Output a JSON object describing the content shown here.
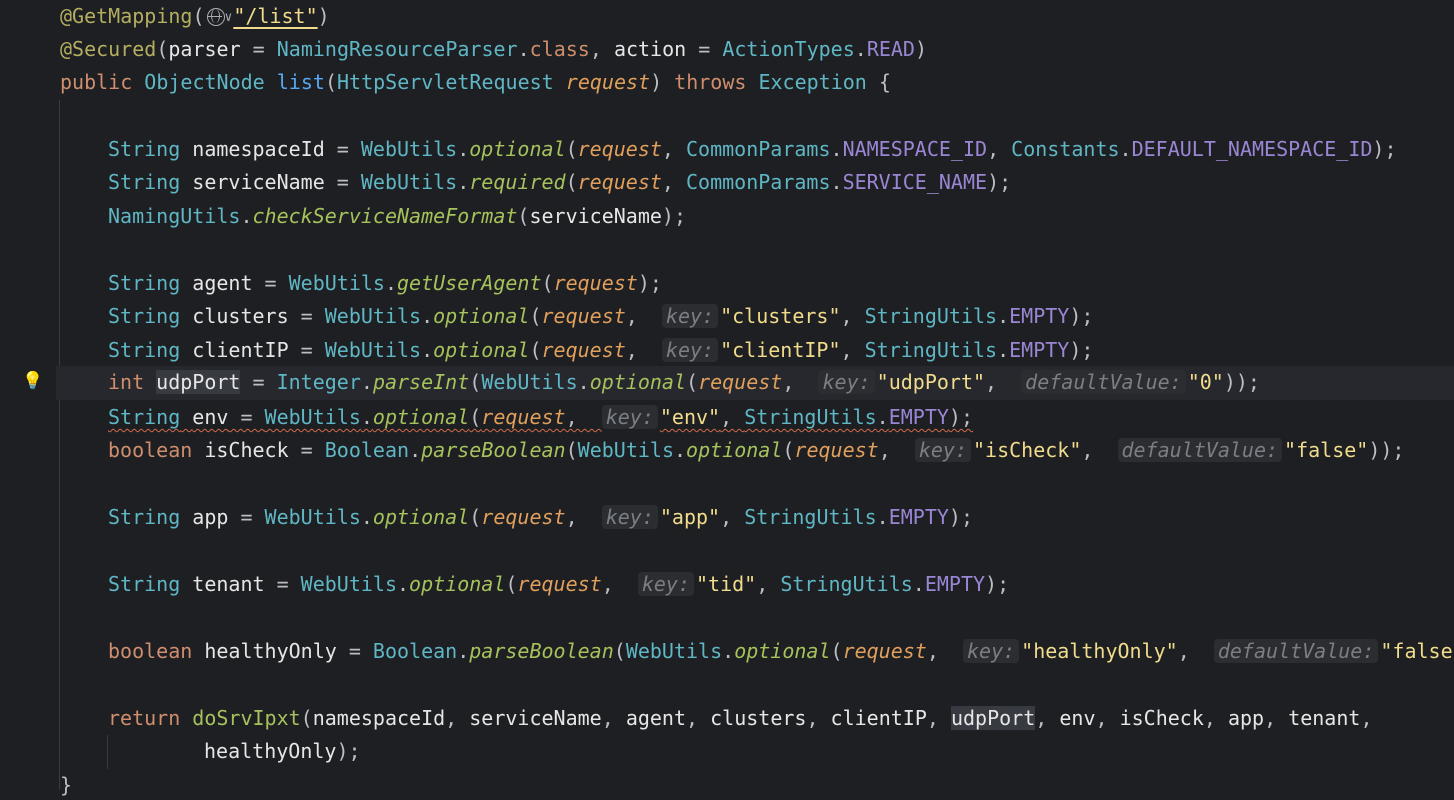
{
  "editor": {
    "gutter": {
      "intention_bulb": "lightbulb-icon"
    },
    "annotations": {
      "get_mapping": "@GetMapping",
      "globe_icon": "globe-icon",
      "dropdown": "v",
      "path": "\"/list\"",
      "secured": "@Secured",
      "parser_attr": "parser",
      "parser_value": "NamingResourceParser",
      "class_kw": "class",
      "action_attr": "action",
      "action_types": "ActionTypes",
      "read": "READ"
    },
    "signature": {
      "public": "public",
      "return_type": "ObjectNode",
      "name": "list",
      "param_type": "HttpServletRequest",
      "param_name": "request",
      "throws": "throws",
      "exception": "Exception"
    },
    "hints": {
      "key": "key:",
      "default_value": "defaultValue:"
    },
    "lines": {
      "l4": {
        "type": "String",
        "var": "namespaceId",
        "cls": "WebUtils",
        "method": "optional",
        "arg": "request",
        "c1": "CommonParams",
        "f1": "NAMESPACE_ID",
        "c2": "Constants",
        "f2": "DEFAULT_NAMESPACE_ID"
      },
      "l5": {
        "type": "String",
        "var": "serviceName",
        "cls": "WebUtils",
        "method": "required",
        "arg": "request",
        "c1": "CommonParams",
        "f1": "SERVICE_NAME"
      },
      "l6": {
        "cls": "NamingUtils",
        "method": "checkServiceNameFormat",
        "arg": "serviceName"
      },
      "l8": {
        "type": "String",
        "var": "agent",
        "cls": "WebUtils",
        "method": "getUserAgent",
        "arg": "request"
      },
      "l9": {
        "type": "String",
        "var": "clusters",
        "cls": "WebUtils",
        "method": "optional",
        "arg": "request",
        "key": "\"clusters\"",
        "c1": "StringUtils",
        "f1": "EMPTY"
      },
      "l10": {
        "type": "String",
        "var": "clientIP",
        "cls": "WebUtils",
        "method": "optional",
        "arg": "request",
        "key": "\"clientIP\"",
        "c1": "StringUtils",
        "f1": "EMPTY"
      },
      "l11": {
        "type": "int",
        "var": "udpPort",
        "cls": "Integer",
        "method": "parseInt",
        "cls2": "WebUtils",
        "method2": "optional",
        "arg": "request",
        "key": "\"udpPort\"",
        "def": "\"0\""
      },
      "l12": {
        "type": "String",
        "var": "env",
        "cls": "WebUtils",
        "method": "optional",
        "arg": "request",
        "key": "\"env\"",
        "c1": "StringUtils",
        "f1": "EMPTY"
      },
      "l13": {
        "type": "boolean",
        "var": "isCheck",
        "cls": "Boolean",
        "method": "parseBoolean",
        "cls2": "WebUtils",
        "method2": "optional",
        "arg": "request",
        "key": "\"isCheck\"",
        "def": "\"false\""
      },
      "l15": {
        "type": "String",
        "var": "app",
        "cls": "WebUtils",
        "method": "optional",
        "arg": "request",
        "key": "\"app\"",
        "c1": "StringUtils",
        "f1": "EMPTY"
      },
      "l17": {
        "type": "String",
        "var": "tenant",
        "cls": "WebUtils",
        "method": "optional",
        "arg": "request",
        "key": "\"tid\"",
        "c1": "StringUtils",
        "f1": "EMPTY"
      },
      "l19": {
        "type": "boolean",
        "var": "healthyOnly",
        "cls": "Boolean",
        "method": "parseBoolean",
        "cls2": "WebUtils",
        "method2": "optional",
        "arg": "request",
        "key": "\"healthyOnly\"",
        "def": "\"false\""
      },
      "l21": {
        "kw": "return",
        "method": "doSrvIpxt",
        "a1": "namespaceId",
        "a2": "serviceName",
        "a3": "agent",
        "a4": "clusters",
        "a5": "clientIP",
        "a6": "udpPort",
        "a7": "env",
        "a8": "isCheck",
        "a9": "app",
        "a10": "tenant"
      },
      "l22": {
        "a11": "healthyOnly"
      }
    }
  }
}
